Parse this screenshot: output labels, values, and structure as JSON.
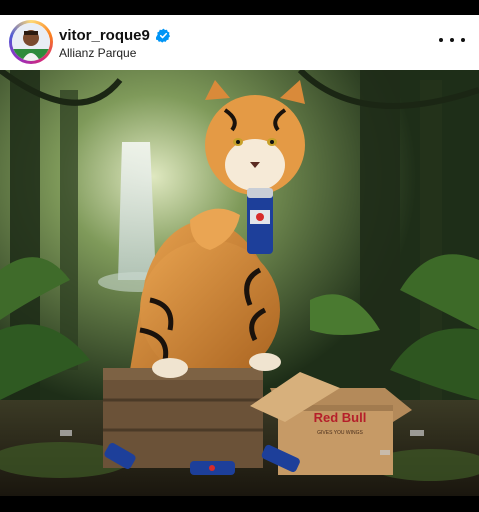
{
  "post": {
    "username": "vitor_roque9",
    "location": "Allianz Parque",
    "verified": true
  },
  "icons": {
    "verified": "verified-badge-icon",
    "more": "more-options-icon"
  },
  "colors": {
    "verified_blue": "#0095f6",
    "can_blue": "#1d3f9a"
  },
  "photo": {
    "box_brand": "Red Bull",
    "box_tagline": "GIVES YOU WINGS"
  }
}
